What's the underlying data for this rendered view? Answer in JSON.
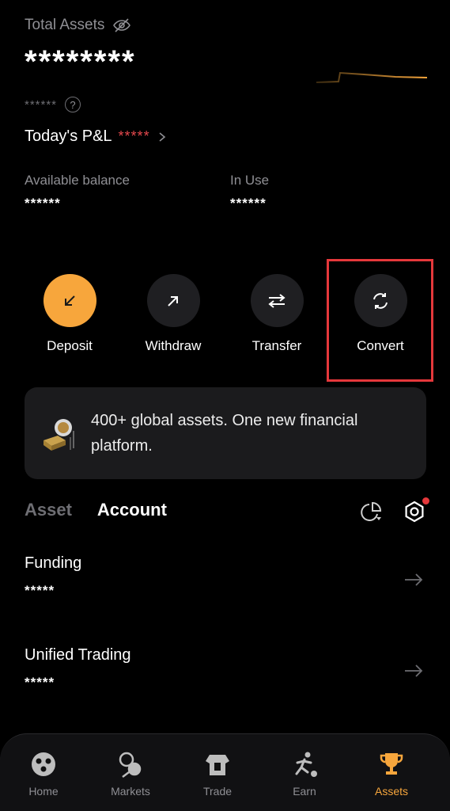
{
  "header": {
    "total_assets_label": "Total Assets",
    "total_assets_value": "********",
    "sub_value_masked": "******",
    "help_icon_glyph": "?",
    "pnl_label": "Today's P&L",
    "pnl_value": "*****"
  },
  "balances": {
    "available_label": "Available balance",
    "available_value": "******",
    "in_use_label": "In Use",
    "in_use_value": "******"
  },
  "actions": [
    {
      "label": "Deposit",
      "icon": "arrow-down-left-icon"
    },
    {
      "label": "Withdraw",
      "icon": "arrow-up-right-icon"
    },
    {
      "label": "Transfer",
      "icon": "swap-arrows-icon"
    },
    {
      "label": "Convert",
      "icon": "refresh-icon"
    }
  ],
  "banner": {
    "text": "400+ global assets. One new financial platform."
  },
  "tabs": {
    "asset": "Asset",
    "account": "Account",
    "active": "Account"
  },
  "accounts": [
    {
      "name": "Funding",
      "value": "*****"
    },
    {
      "name": "Unified Trading",
      "value": "*****"
    }
  ],
  "bottom_nav": [
    {
      "label": "Home",
      "icon": "home-icon",
      "active": false
    },
    {
      "label": "Markets",
      "icon": "markets-icon",
      "active": false
    },
    {
      "label": "Trade",
      "icon": "trade-icon",
      "active": false
    },
    {
      "label": "Earn",
      "icon": "earn-icon",
      "active": false
    },
    {
      "label": "Assets",
      "icon": "trophy-icon",
      "active": true
    }
  ],
  "colors": {
    "accent": "#f7a63c",
    "negative": "#e5484d",
    "highlight_box": "#e5383b",
    "background": "#000000",
    "card": "#1b1b1d"
  }
}
